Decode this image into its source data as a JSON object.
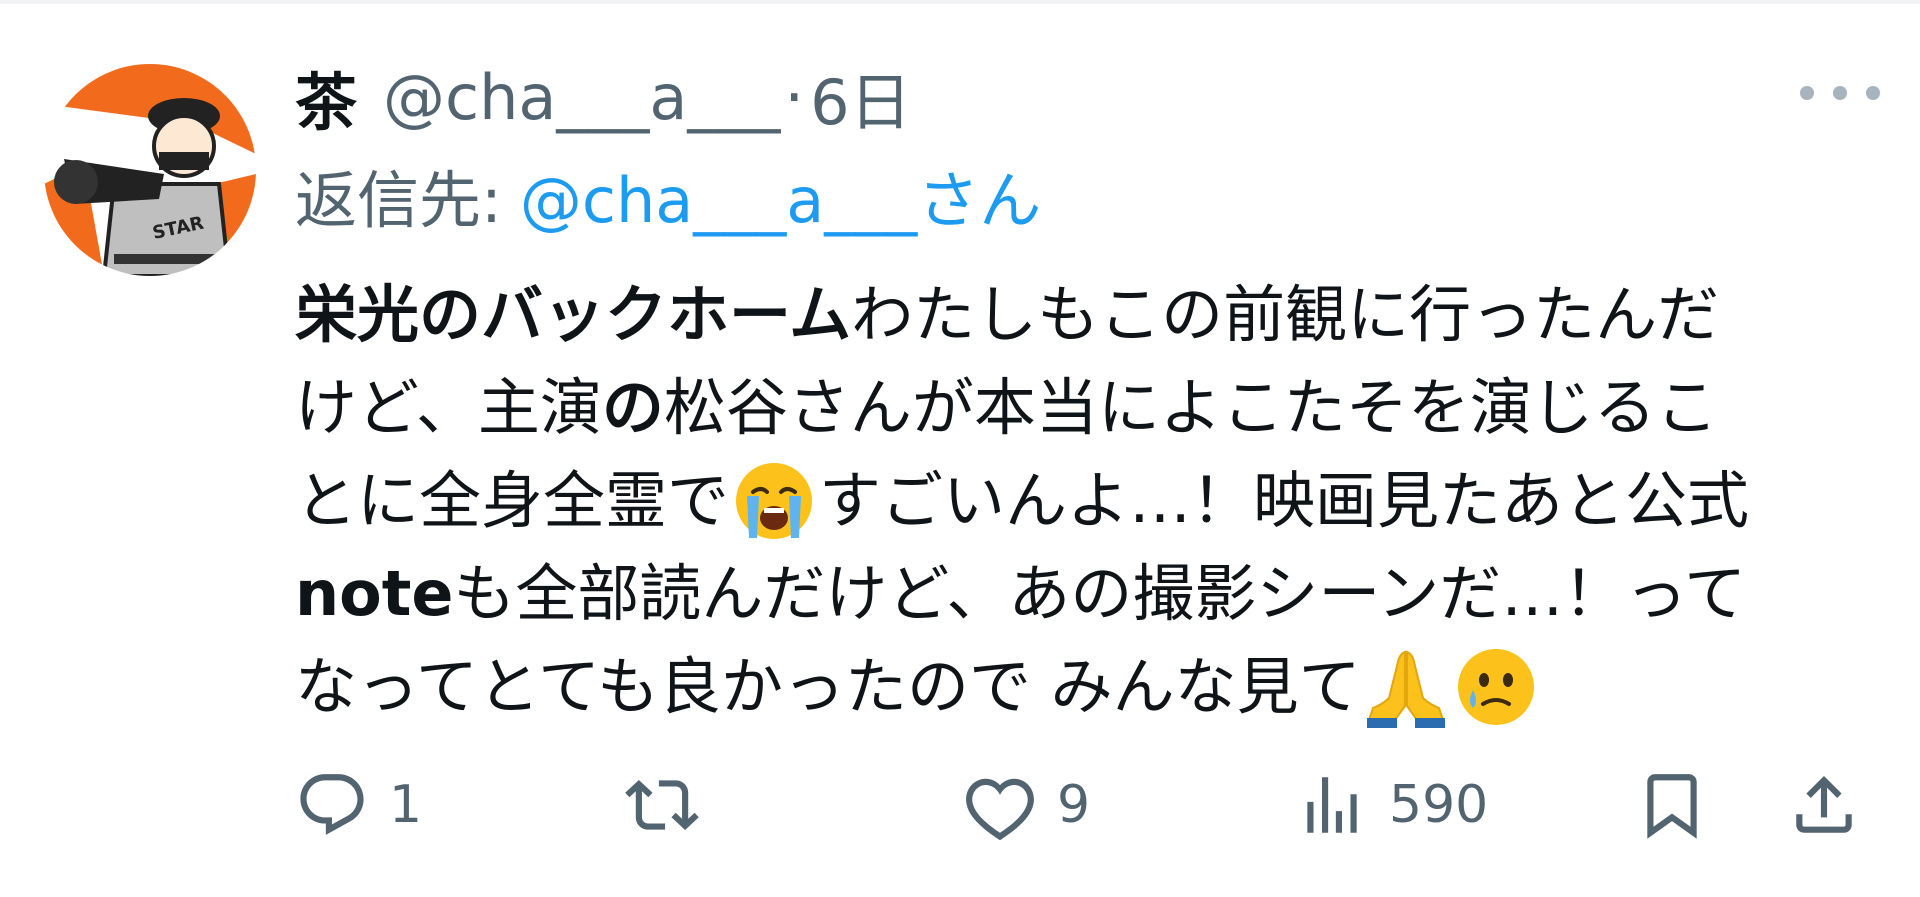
{
  "tweet": {
    "author": {
      "display_name": "茶",
      "handle": "@cha___a___",
      "separator": "·",
      "timestamp": "6日",
      "avatar_icon": "avatar-baseball-player"
    },
    "reply_to": {
      "label": "返信先:",
      "handle": "@cha___a___さん"
    },
    "body": {
      "line1_bold": "栄光のバックホーム",
      "line1_rest": "わたしもこの前観に行ったんだ",
      "line2_a": "けど、主演",
      "line2_bold": "の",
      "line2_b": "松谷さんが本当によこたそを演じるこ",
      "line3_a": "とに全身全霊で",
      "line3_emoji": "loudly-crying-face-emoji",
      "line3_b": "すごいんよ…！映画見たあと公式",
      "line4_bold": "note",
      "line4_rest": "も全部読んだけど、あの撮影シーンだ…！って",
      "line5_text": "なってとても良かったので みんな見て",
      "line5_emojis": [
        "folded-hands-emoji",
        "face-holding-back-tears-emoji"
      ]
    },
    "actions": {
      "reply_count": "1",
      "retweet_count": "",
      "like_count": "9",
      "view_count": "590"
    },
    "colors": {
      "text_primary": "#0f1419",
      "text_secondary": "#536471",
      "link": "#1d9bf0",
      "more_dots": "#a7b3bd"
    }
  }
}
